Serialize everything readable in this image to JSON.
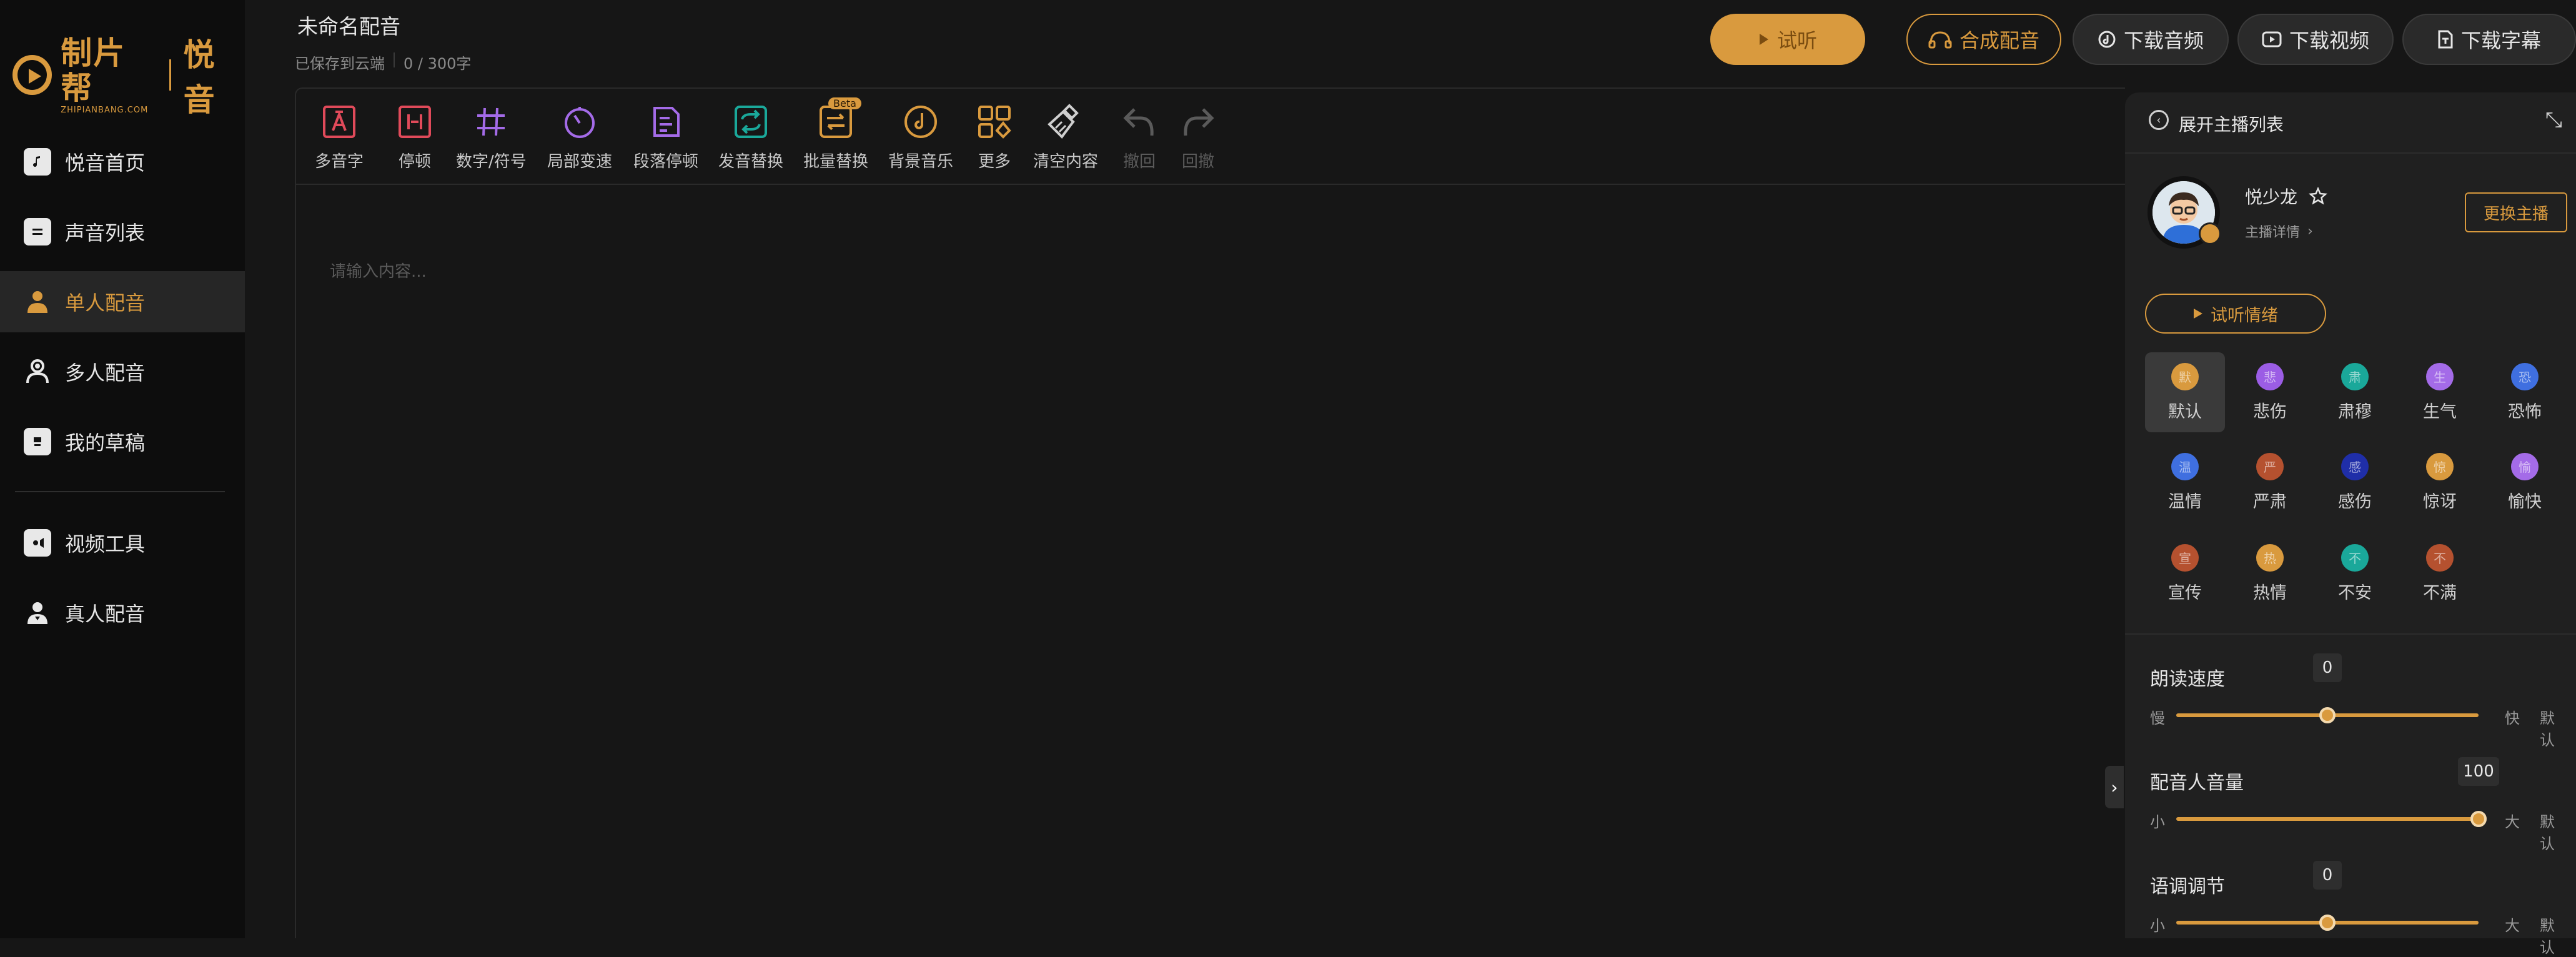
{
  "brand": {
    "name": "制片帮",
    "sub": "ZHIPIANBANG.COM",
    "product": "悦音"
  },
  "colors": {
    "accent": "#d99a3e",
    "background": "#161616",
    "sidebar": "#0d0d0d",
    "panel": "#202020"
  },
  "sidebar": {
    "items": [
      {
        "label": "悦音首页",
        "icon": "music-note-icon"
      },
      {
        "label": "声音列表",
        "icon": "list-icon"
      },
      {
        "label": "单人配音",
        "icon": "person-icon",
        "active": true
      },
      {
        "label": "多人配音",
        "icon": "people-icon"
      },
      {
        "label": "我的草稿",
        "icon": "draft-icon"
      },
      {
        "label": "视频工具",
        "icon": "video-icon"
      },
      {
        "label": "真人配音",
        "icon": "real-person-icon"
      }
    ]
  },
  "header": {
    "title": "未命名配音",
    "saved_status": "已保存到云端",
    "char_count": "0 / 300字",
    "listen_label": "试听",
    "synthesize_label": "合成配音",
    "download_audio_label": "下载音频",
    "download_video_label": "下载视频",
    "download_subtitle_label": "下载字幕"
  },
  "toolbar": {
    "tools": [
      {
        "label": "多音字",
        "icon": "polyphone-icon"
      },
      {
        "label": "停顿",
        "icon": "pause-icon"
      },
      {
        "label": "数字/符号",
        "icon": "hash-icon"
      },
      {
        "label": "局部变速",
        "icon": "speed-icon"
      },
      {
        "label": "段落停顿",
        "icon": "paragraph-pause-icon"
      },
      {
        "label": "发音替换",
        "icon": "replace-icon"
      },
      {
        "label": "批量替换",
        "icon": "batch-replace-icon",
        "badge": "Beta"
      },
      {
        "label": "背景音乐",
        "icon": "background-music-icon"
      },
      {
        "label": "更多",
        "icon": "more-grid-icon"
      },
      {
        "label": "清空内容",
        "icon": "broom-icon"
      },
      {
        "label": "撤回",
        "icon": "undo-icon",
        "disabled": true
      },
      {
        "label": "回撤",
        "icon": "redo-icon",
        "disabled": true
      }
    ]
  },
  "editor": {
    "placeholder": "请输入内容..."
  },
  "panel": {
    "expand_label": "展开主播列表",
    "anchor_name": "悦少龙",
    "anchor_detail": "主播详情",
    "change_anchor_label": "更换主播",
    "emotion_listen_label": "试听情绪",
    "emotions": [
      {
        "label": "默认",
        "glyph": "默",
        "color": "#d99a3e",
        "active": true
      },
      {
        "label": "悲伤",
        "glyph": "悲",
        "color": "#9b5de5"
      },
      {
        "label": "肃穆",
        "glyph": "肃",
        "color": "#1aa89a"
      },
      {
        "label": "生气",
        "glyph": "生",
        "color": "#a46be8"
      },
      {
        "label": "恐怖",
        "glyph": "恐",
        "color": "#3f6fe0"
      },
      {
        "label": "温情",
        "glyph": "温",
        "color": "#3f6fe0"
      },
      {
        "label": "严肃",
        "glyph": "严",
        "color": "#b5512f"
      },
      {
        "label": "感伤",
        "glyph": "感",
        "color": "#1f2ea8"
      },
      {
        "label": "惊讶",
        "glyph": "惊",
        "color": "#d99a3e"
      },
      {
        "label": "愉快",
        "glyph": "愉",
        "color": "#a46be8"
      },
      {
        "label": "宣传",
        "glyph": "宣",
        "color": "#b5512f"
      },
      {
        "label": "热情",
        "glyph": "热",
        "color": "#d99a3e"
      },
      {
        "label": "不安",
        "glyph": "不",
        "color": "#1aa89a"
      },
      {
        "label": "不满",
        "glyph": "不",
        "color": "#b5512f"
      }
    ],
    "sliders": [
      {
        "title": "朗读速度",
        "value": "0",
        "min_label": "慢",
        "max_label": "快",
        "default_label": "默认",
        "level": 0.5
      },
      {
        "title": "配音人音量",
        "value": "100",
        "min_label": "小",
        "max_label": "大",
        "default_label": "默认",
        "level": 1.0
      },
      {
        "title": "语调调节",
        "value": "0",
        "min_label": "小",
        "max_label": "大",
        "default_label": "默认",
        "level": 0.5
      }
    ]
  }
}
